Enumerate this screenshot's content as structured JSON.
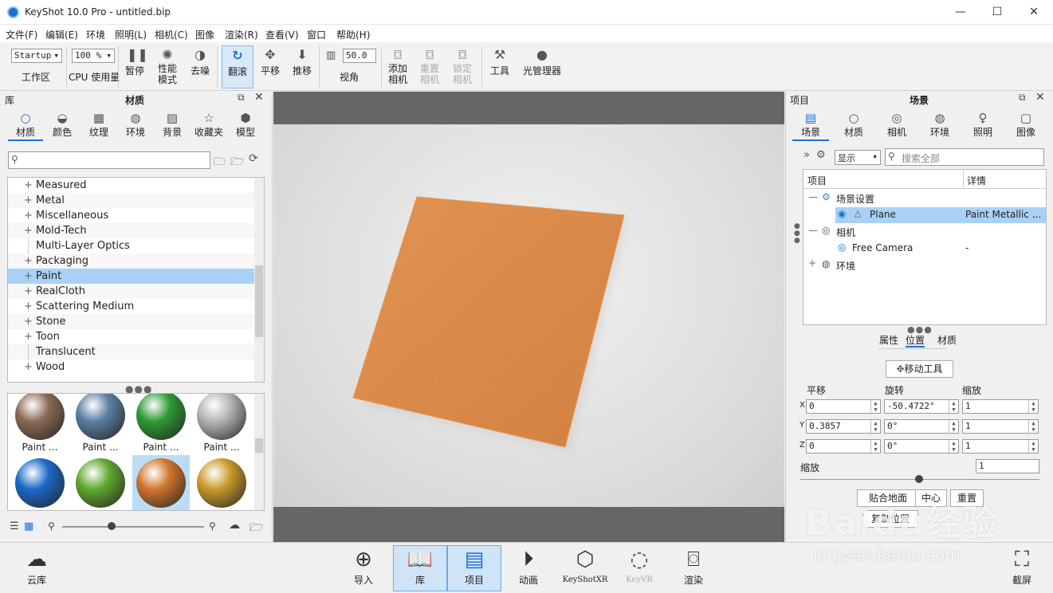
{
  "window": {
    "title": "KeyShot 10.0 Pro  - untitled.bip",
    "min": "—",
    "max": "☐",
    "close": "✕"
  },
  "menu": [
    "文件(F)",
    "编辑(E)",
    "环境",
    "照明(L)",
    "相机(C)",
    "图像",
    "渲染(R)",
    "查看(V)",
    "窗口",
    "帮助(H)"
  ],
  "toolbar": {
    "workspace_value": "Startup",
    "workspace_label": "工作区",
    "cpu_value": "100 %",
    "cpu_label": "CPU 使用量",
    "pause": "暂停",
    "perf_mode": "性能\n模式",
    "denoise": "去噪",
    "tumble": "翻滚",
    "pan": "平移",
    "dolly": "推移",
    "fov_value": "50.0",
    "fov_label": "视角",
    "add_camera": "添加\n相机",
    "reset_camera": "重置\n相机",
    "lock_camera": "锁定\n相机",
    "tools": "工具",
    "light_manager": "光管理器"
  },
  "library": {
    "title": "库",
    "subtitle": "材质",
    "tabs": [
      "材质",
      "颜色",
      "纹理",
      "环境",
      "背景",
      "收藏夹",
      "模型"
    ],
    "tab_icons": [
      "○",
      "◒",
      "▦",
      "◍",
      "▨",
      "☆",
      "⬢"
    ],
    "search_placeholder": "",
    "tree": [
      {
        "label": "Measured",
        "plus": "+"
      },
      {
        "label": "Metal",
        "plus": "+"
      },
      {
        "label": "Miscellaneous",
        "plus": "+"
      },
      {
        "label": "Mold-Tech",
        "plus": "+"
      },
      {
        "label": "Multi-Layer Optics",
        "plus": ""
      },
      {
        "label": "Packaging",
        "plus": "+"
      },
      {
        "label": "Paint",
        "plus": "+"
      },
      {
        "label": "RealCloth",
        "plus": "+"
      },
      {
        "label": "Scattering Medium",
        "plus": "+"
      },
      {
        "label": "Stone",
        "plus": "+"
      },
      {
        "label": "Toon",
        "plus": "+"
      },
      {
        "label": "Translucent",
        "plus": ""
      },
      {
        "label": "Wood",
        "plus": "+"
      }
    ],
    "thumbs": [
      {
        "label": "Paint ...",
        "color": "#8a6a55"
      },
      {
        "label": "Paint ...",
        "color": "#5a7ea0"
      },
      {
        "label": "Paint ...",
        "color": "#2e9a36"
      },
      {
        "label": "Paint ...",
        "color": "#b5b5b5"
      },
      {
        "label": "Paint ...",
        "color": "#1a68c8"
      },
      {
        "label": "Paint ...",
        "color": "#5fa82e"
      },
      {
        "label": "Paint ...",
        "color": "#d0742a"
      },
      {
        "label": "Paint ...",
        "color": "#c99a2a"
      }
    ]
  },
  "project": {
    "title": "项目",
    "subtitle": "场景",
    "tabs": [
      "场景",
      "材质",
      "相机",
      "环境",
      "照明",
      "图像"
    ],
    "tab_icons": [
      "▤",
      "○",
      "◎",
      "◍",
      "♀",
      "▢"
    ],
    "show_label": "显示",
    "search_placeholder": "搜索全部",
    "col_item": "项目",
    "col_detail": "详情",
    "tree": [
      {
        "label": "场景设置",
        "detail": ""
      },
      {
        "label": "Plane",
        "detail": "Paint Metallic ..."
      },
      {
        "label": "相机",
        "detail": ""
      },
      {
        "label": "Free Camera",
        "detail": "-"
      },
      {
        "label": "环境",
        "detail": ""
      }
    ],
    "subtabs": [
      "属性",
      "位置",
      "材质"
    ],
    "move_tool": "移动工具",
    "translate": "平移",
    "rotate": "旋转",
    "scale": "缩放",
    "x": "X",
    "y": "Y",
    "z": "Z",
    "tx": "0",
    "ty": "0.3857",
    "tz": "0",
    "rx": "-50.4722°",
    "ry": "0°",
    "rz": "0°",
    "sx": "1",
    "sy": "1",
    "sz": "1",
    "uniform_scale_label": "缩放",
    "uniform_scale": "1",
    "snap_ground": "贴合地面",
    "center": "中心",
    "reset": "重置",
    "copy_pos": "复制位置"
  },
  "bottom": {
    "cloud": "云库",
    "import": "导入",
    "library": "库",
    "project": "项目",
    "animation": "动画",
    "keyshotxr": "KeyShotXR",
    "keyvr": "KeyVR",
    "render": "渲染",
    "screenshot": "截屏"
  },
  "watermark": {
    "brand": "Baidu经验",
    "url": "jingyan.baidu.com"
  },
  "colors": {
    "accent": "#1d6fd0",
    "selection": "#a9d1f5",
    "plane": "#e8873a"
  }
}
